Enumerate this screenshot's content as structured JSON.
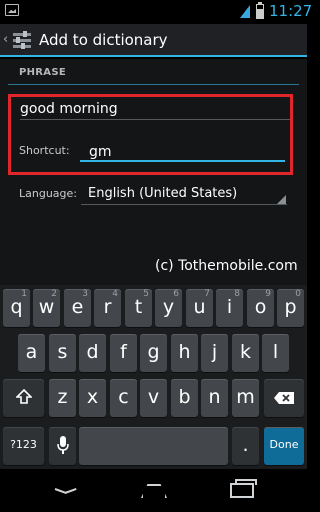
{
  "status_bar": {
    "time": "11:27",
    "icons": [
      "notification-image-icon",
      "signal-icon",
      "battery-icon"
    ]
  },
  "action_bar": {
    "title": "Add to dictionary",
    "icons": [
      "back-chevron-icon",
      "app-settings-icon"
    ]
  },
  "form": {
    "phrase_header": "PHRASE",
    "phrase_value": "good morning",
    "shortcut_label": "Shortcut:",
    "shortcut_value": "gm",
    "language_label": "Language:",
    "language_value": "English (United States)"
  },
  "watermark": "(c) Tothemobile.com",
  "keyboard": {
    "row1": [
      {
        "label": "q",
        "hint": "1"
      },
      {
        "label": "w",
        "hint": "2"
      },
      {
        "label": "e",
        "hint": "3"
      },
      {
        "label": "r",
        "hint": "4"
      },
      {
        "label": "t",
        "hint": "5"
      },
      {
        "label": "y",
        "hint": "6"
      },
      {
        "label": "u",
        "hint": "7"
      },
      {
        "label": "i",
        "hint": "8"
      },
      {
        "label": "o",
        "hint": "9"
      },
      {
        "label": "p",
        "hint": "0"
      }
    ],
    "row2": [
      "a",
      "s",
      "d",
      "f",
      "g",
      "h",
      "j",
      "k",
      "l"
    ],
    "row3": [
      "z",
      "x",
      "c",
      "v",
      "b",
      "n",
      "m"
    ],
    "symbols_label": "?123",
    "done_label": "Done",
    "period_label": ".",
    "icons": [
      "shift-icon",
      "backspace-icon",
      "microphone-icon"
    ]
  },
  "nav_bar": {
    "icons": [
      "nav-back-icon",
      "nav-home-icon",
      "nav-recent-apps-icon"
    ]
  },
  "colors": {
    "accent": "#33b5e5",
    "highlight_box": "#e0252b",
    "done_key": "#0f6b98"
  }
}
